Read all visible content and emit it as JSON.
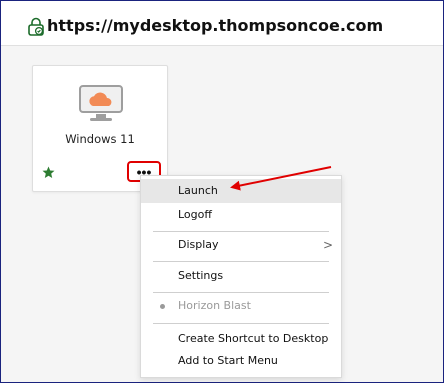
{
  "header": {
    "url": "https://mydesktop.thompsoncoe.com",
    "icon": "lock-icon"
  },
  "desktop_tile": {
    "name": "Windows 11",
    "icon": "cloud-monitor-icon",
    "favorite_icon": "star-icon",
    "more_label": "•••"
  },
  "context_menu": {
    "items": [
      {
        "label": "Launch"
      },
      {
        "label": "Logoff"
      },
      {
        "label": "Display",
        "submenu_icon": ">"
      },
      {
        "label": "Settings"
      },
      {
        "label": "Horizon Blast"
      },
      {
        "label": "Create Shortcut to Desktop"
      },
      {
        "label": "Add to Start Menu"
      }
    ]
  },
  "colors": {
    "annotation": "#e00000",
    "accent_orange": "#f28b56",
    "star_green": "#2e7d32",
    "frame_border": "#1a237e"
  }
}
